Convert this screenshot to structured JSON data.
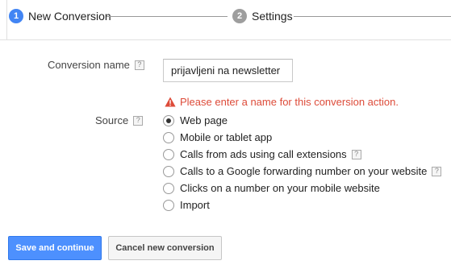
{
  "steps": [
    {
      "number": "1",
      "label": "New Conversion",
      "active": true
    },
    {
      "number": "2",
      "label": "Settings",
      "active": false
    }
  ],
  "form": {
    "conversion_name": {
      "label": "Conversion name",
      "help": "?",
      "value": "prijavljeni na newsletter"
    },
    "error": "Please enter a name for this conversion action.",
    "source": {
      "label": "Source",
      "help": "?",
      "options": [
        {
          "label": "Web page",
          "selected": true,
          "help": ""
        },
        {
          "label": "Mobile or tablet app",
          "selected": false,
          "help": ""
        },
        {
          "label": "Calls from ads using call extensions",
          "selected": false,
          "help": "?"
        },
        {
          "label": "Calls to a Google forwarding number on your website",
          "selected": false,
          "help": "?"
        },
        {
          "label": "Clicks on a number on your mobile website",
          "selected": false,
          "help": ""
        },
        {
          "label": "Import",
          "selected": false,
          "help": ""
        }
      ]
    }
  },
  "buttons": {
    "save": "Save and continue",
    "cancel": "Cancel new conversion"
  },
  "colors": {
    "primary": "#4d90fe",
    "step_active": "#4285f4",
    "step_inactive": "#9e9e9e",
    "error": "#dd4b39"
  }
}
